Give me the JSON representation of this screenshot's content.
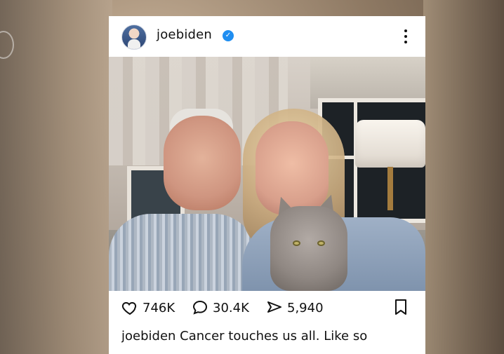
{
  "post": {
    "username": "joebiden",
    "verified": true,
    "stats": {
      "likes": "746K",
      "comments": "30.4K",
      "shares": "5,940"
    },
    "caption": {
      "author": "joebiden",
      "text": "Cancer touches us all. Like so"
    },
    "icons": {
      "avatar": "avatar",
      "verified": "verified-badge-icon",
      "more": "more-vertical-icon",
      "like": "heart-icon",
      "comment": "comment-icon",
      "share": "share-icon",
      "save": "bookmark-icon"
    },
    "colors": {
      "verified": "#1f8ef1",
      "background_warm": "#8f7a64",
      "card": "#ffffff"
    }
  }
}
